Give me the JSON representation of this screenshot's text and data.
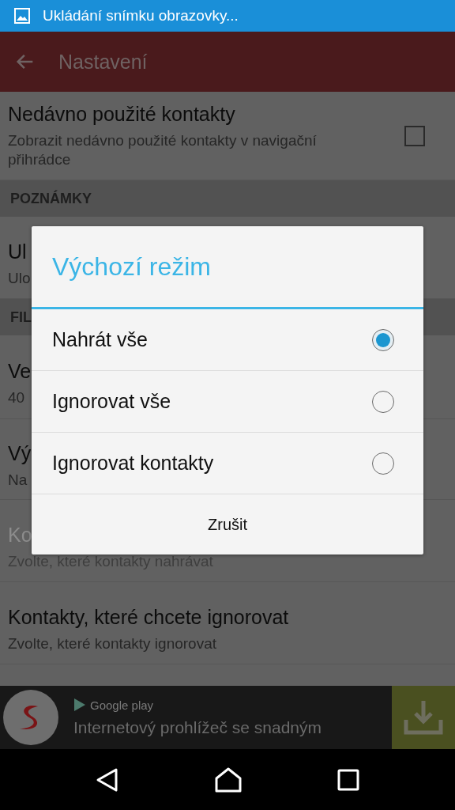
{
  "status_bar": {
    "text": "Ukládání snímku obrazovky..."
  },
  "toolbar": {
    "title": "Nastavení"
  },
  "settings": [
    {
      "kind": "item",
      "title": "Nedávno použité kontakty",
      "subtitle": "Zobrazit nedávno použité kontakty v navigační přihrádce",
      "checked": false,
      "disabled": false
    },
    {
      "kind": "header",
      "title": "POZNÁMKY"
    },
    {
      "kind": "item",
      "title": "Ul",
      "subtitle": "Ulo",
      "disabled": false
    },
    {
      "kind": "header",
      "title": "FIL"
    },
    {
      "kind": "item",
      "title": "Ve",
      "subtitle": "40",
      "disabled": false
    },
    {
      "kind": "item",
      "title": "Vý",
      "subtitle": "Na",
      "disabled": false
    },
    {
      "kind": "item",
      "title": "Ko",
      "subtitle": "Zvolte, které kontakty nahrávat",
      "disabled": true
    },
    {
      "kind": "item",
      "title": "Kontakty, které chcete ignorovat",
      "subtitle": "Zvolte, které kontakty ignorovat",
      "disabled": false
    }
  ],
  "dialog": {
    "title": "Výchozí režim",
    "options": [
      {
        "label": "Nahrát vše",
        "selected": true
      },
      {
        "label": "Ignorovat vše",
        "selected": false
      },
      {
        "label": "Ignorovat kontakty",
        "selected": false
      }
    ],
    "button": "Zrušit"
  },
  "ad": {
    "store": "Google play",
    "text": "Internetový prohlížeč se snadným"
  }
}
